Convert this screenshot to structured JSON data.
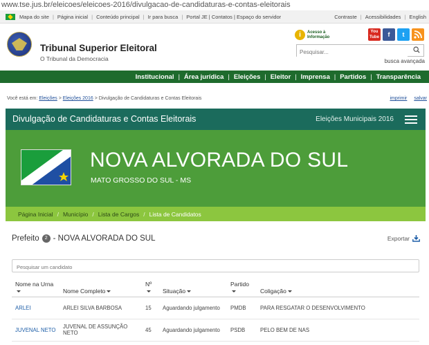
{
  "url": "www.tse.jus.br/eleicoes/eleicoes-2016/divulgacao-de-candidaturas-e-contas-eleitorais",
  "govbar": {
    "left": [
      "Mapa do site",
      "Página inicial",
      "Conteúdo principal",
      "Ir para busca",
      "Portal JE | Contatos | Espaço do servidor"
    ],
    "right": [
      "Contraste",
      "Acessibilidades",
      "English"
    ]
  },
  "header": {
    "title": "Tribunal Superior Eleitoral",
    "subtitle": "O Tribunal da Democracia",
    "acesso_line1": "Acesso à",
    "acesso_line2": "Informação",
    "search_placeholder": "Pesquisar...",
    "busca_avancada": "busca avançada",
    "social": [
      {
        "label": "You Tube",
        "color": "#d82a20"
      },
      {
        "label": "f",
        "color": "#3b5998"
      },
      {
        "label": "t",
        "color": "#1da1f2"
      },
      {
        "label": "rss",
        "color": "#f7931e"
      }
    ]
  },
  "nav": [
    "Institucional",
    "Área jurídica",
    "Eleições",
    "Eleitor",
    "Imprensa",
    "Partidos",
    "Transparência"
  ],
  "crumb": {
    "prefix": "Você está em:",
    "links": [
      "Eleições",
      "Eleições 2016"
    ],
    "current": "Divulgação de Candidaturas e Contas Eleitorais",
    "imprimir": "imprimir",
    "salvar": "salvar"
  },
  "titlebar": {
    "title": "Divulgação de Candidaturas e Contas Eleitorais",
    "right": "Eleições Municipais 2016"
  },
  "banner": {
    "city": "NOVA ALVORADA DO SUL",
    "state": "MATO GROSSO DO SUL - MS"
  },
  "subnav": [
    "Página Inicial",
    "Município",
    "Lista de Cargos",
    "Lista de Candidatos"
  ],
  "content": {
    "cargo": "Prefeito",
    "count": "2",
    "municipio": "- NOVA ALVORADA DO SUL",
    "exportar": "Exportar",
    "search_placeholder": "Pesquisar um candidato"
  },
  "table": {
    "headers": [
      "Nome na Urna",
      "Nome Completo",
      "Nº",
      "Situação",
      "Partido",
      "Coligação"
    ],
    "rows": [
      {
        "urna": "ARLEI",
        "completo": "ARLEI SILVA BARBOSA",
        "numero": "15",
        "situacao": "Aguardando julgamento",
        "partido": "PMDB",
        "coligacao": "PARA RESGATAR O DESENVOLVIMENTO"
      },
      {
        "urna": "JUVENAL NETO",
        "completo": "JUVENAL DE ASSUNÇÃO NETO",
        "numero": "45",
        "situacao": "Aguardando julgamento",
        "partido": "PSDB",
        "coligacao": "PELO BEM DE NAS"
      }
    ]
  }
}
